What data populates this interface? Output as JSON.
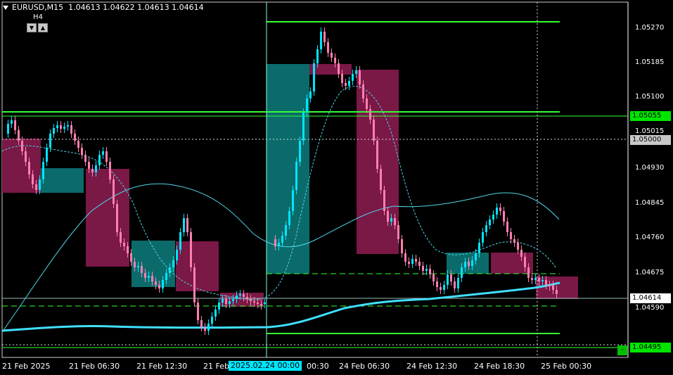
{
  "header": {
    "symbol": "EURUSD,M15",
    "ohlc": "1.04613 1.04622 1.04613 1.04614"
  },
  "timeframe": {
    "label": "H4",
    "down_glyph": "▼",
    "up_glyph": "▲"
  },
  "price_axis": {
    "labels": [
      "1.05270",
      "1.05185",
      "1.05100",
      "1.05015",
      "1.04930",
      "1.04845",
      "1.04760",
      "1.04675",
      "1.04590"
    ],
    "tags": {
      "green_upper": "1.05055",
      "gray": "1.05000",
      "white": "1.04614",
      "green_lower": "1.04495"
    },
    "min_label": "-"
  },
  "time_axis": {
    "labels": [
      "21 Feb 2025",
      "21 Feb 06:30",
      "21 Feb 12:30",
      "21 Feb",
      "00:30",
      "24 Feb 06:30",
      "24 Feb 12:30",
      "24 Feb 18:30",
      "25 Feb 00:30"
    ],
    "cursor_label": "2025.02.24 00:00"
  },
  "colors": {
    "bg": "#000000",
    "grid": "#ffffff",
    "bull": "#00e5ff",
    "bear": "#ff7fb0",
    "teal_box": "#0b6b6b",
    "maroon_box": "#7a1846",
    "level_green": "#33ff33",
    "ma_thick": "#40e0ff",
    "ma_thin": "#4fd5e6"
  }
}
